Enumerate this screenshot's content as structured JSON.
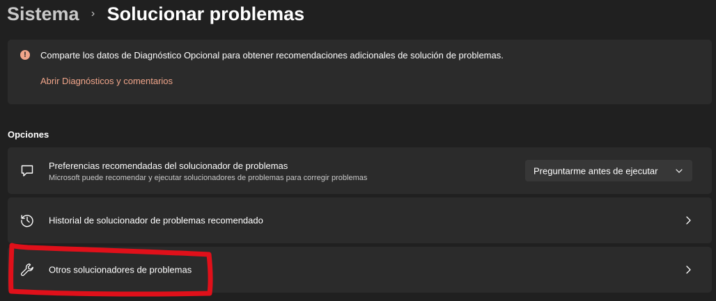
{
  "breadcrumb": {
    "parent": "Sistema",
    "separator": "›",
    "current": "Solucionar problemas"
  },
  "info_banner": {
    "icon": "info-icon",
    "icon_glyph": "!",
    "message": "Comparte los datos de Diagnóstico Opcional para obtener recomendaciones adicionales de solución de problemas.",
    "link": "Abrir Diagnósticos y comentarios",
    "accent_color": "#f0a58a"
  },
  "options": {
    "section_title": "Opciones",
    "items": [
      {
        "icon": "chat-bubble-icon",
        "title": "Preferencias recomendadas del solucionador de problemas",
        "subtitle": "Microsoft puede recomendar y ejecutar solucionadores de problemas para corregir problemas",
        "control": "dropdown",
        "dropdown_value": "Preguntarme antes de ejecutar"
      },
      {
        "icon": "history-icon",
        "title": "Historial de solucionador de problemas recomendado",
        "control": "chevron-right"
      },
      {
        "icon": "wrench-icon",
        "title": "Otros solucionadores de problemas",
        "control": "chevron-right",
        "highlighted": true
      }
    ]
  },
  "colors": {
    "background": "#202020",
    "card": "#2b2b2b",
    "annotation": "#e0101a"
  }
}
